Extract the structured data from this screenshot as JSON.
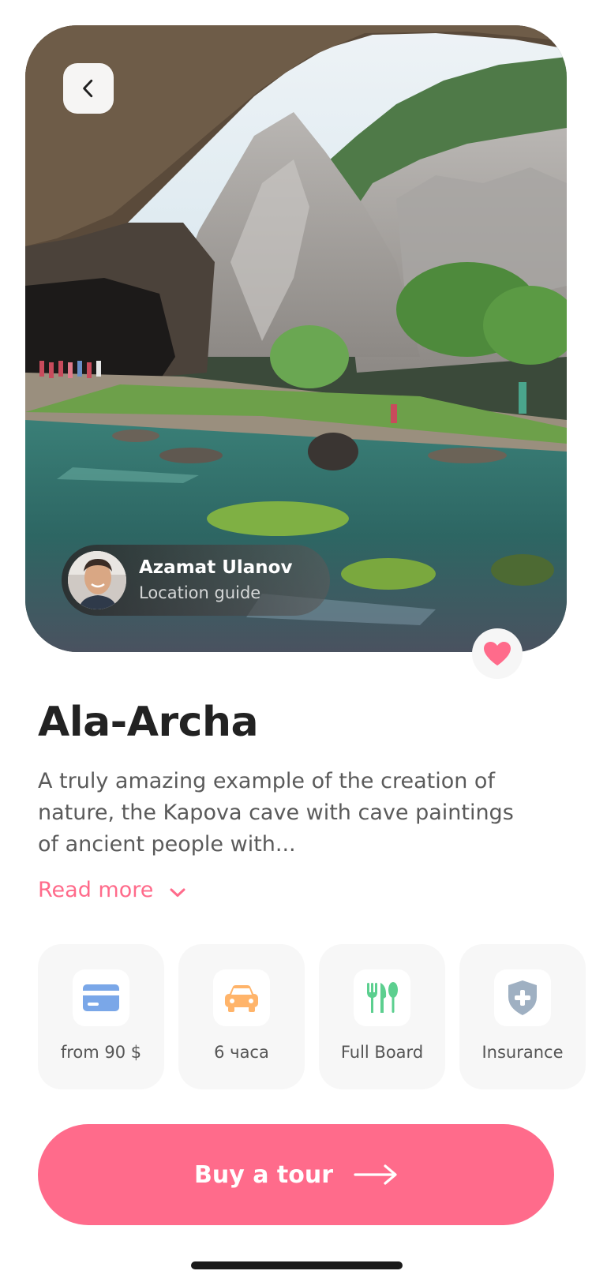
{
  "hero": {
    "image_subject": "cave-mountain-lake-photo"
  },
  "guide": {
    "name": "Azamat Ulanov",
    "role": "Location guide"
  },
  "tour": {
    "title": "Ala-Archa",
    "description": "A truly amazing example of the creation of nature, the Kapova cave with cave paintings of ancient people with...",
    "read_more": "Read more"
  },
  "features": [
    {
      "label": "from 90 $",
      "icon": "credit-card-icon",
      "color": "#7aa7e8"
    },
    {
      "label": "6 часа",
      "icon": "car-icon",
      "color": "#ffb46a"
    },
    {
      "label": "Full Board",
      "icon": "fork-knife-spoon-icon",
      "color": "#5ccf8f"
    },
    {
      "label": "Insurance",
      "icon": "shield-plus-icon",
      "color": "#9fb0c2"
    }
  ],
  "cta": {
    "label": "Buy a tour"
  },
  "colors": {
    "accent": "#ff6b8b",
    "text_primary": "#222222",
    "text_secondary": "#5a5a5a",
    "card_bg": "#f7f7f7"
  }
}
